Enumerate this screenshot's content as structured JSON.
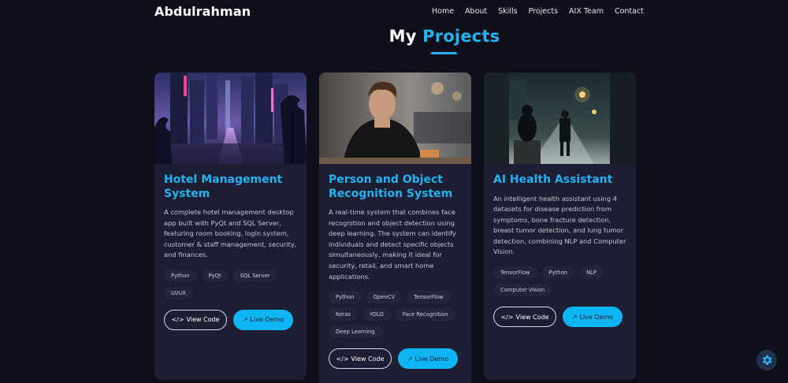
{
  "header": {
    "logo": "Abdulrahman",
    "nav": [
      "Home",
      "About",
      "Skills",
      "Projects",
      "AIX Team",
      "Contact"
    ]
  },
  "section": {
    "title_plain": "My",
    "title_accent": "Projects"
  },
  "projects": [
    {
      "title": "Hotel Management System",
      "description": "A complete hotel management desktop app built with PyQt and SQL Server, featuring room booking, login system, customer & staff management, security, and finances.",
      "tags": [
        "Python",
        "PyQt",
        "SQL Server",
        "UI/UX"
      ],
      "view_code": "View Code",
      "live_demo": "Live Demo"
    },
    {
      "title": "Person and Object Recognition System",
      "description": "A real-time system that combines face recognition and object detection using deep learning. The system can identify individuals and detect specific objects simultaneously, making it ideal for security, retail, and smart home applications.",
      "tags": [
        "Python",
        "OpenCV",
        "TensorFlow",
        "Keras",
        "YOLO",
        "Face Recognition",
        "Deep Learning"
      ],
      "view_code": "View Code",
      "live_demo": "Live Demo"
    },
    {
      "title": "AI Health Assistant",
      "description": "An intelligent health assistant using 4 datasets for disease prediction from symptoms, bone fracture detection, breast tumor detection, and lung tumor detection, combining NLP and Computer Vision.",
      "tags": [
        "TensorFlow",
        "Python",
        "NLP",
        "Computer Vision"
      ],
      "view_code": "View Code",
      "live_demo": "Live Demo"
    }
  ],
  "icons": {
    "view_code": "code-icon",
    "live_demo": "external-link-icon",
    "settings": "gear-icon"
  },
  "colors": {
    "background": "#0f0f1c",
    "card": "#1d1d33",
    "accent": "#22b3f0",
    "button": "#0db5f5"
  }
}
